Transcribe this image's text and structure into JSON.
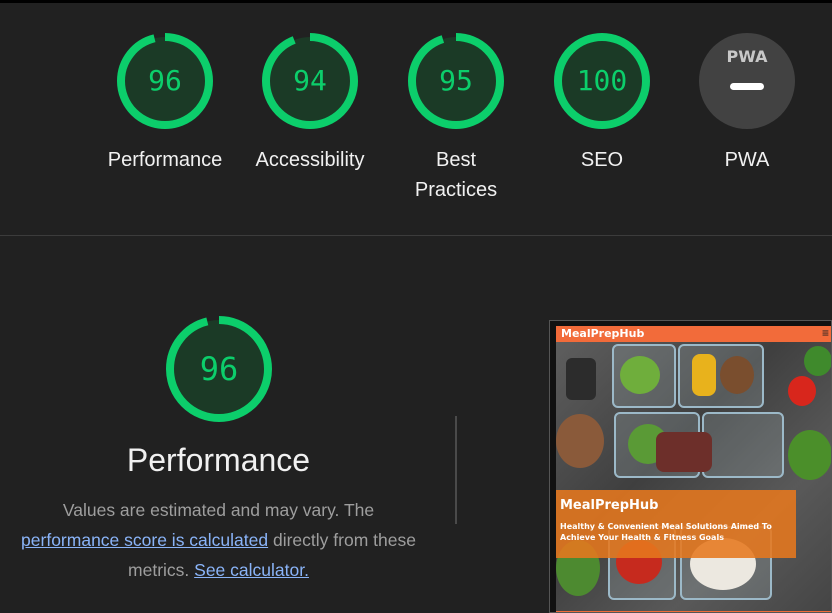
{
  "top_gauges": [
    {
      "score": "96",
      "label": "Performance",
      "fraction": 0.96
    },
    {
      "score": "94",
      "label": "Accessibility",
      "fraction": 0.94
    },
    {
      "score": "95",
      "label": "Best Practices",
      "fraction": 0.95
    },
    {
      "score": "100",
      "label": "SEO",
      "fraction": 1.0
    }
  ],
  "pwa": {
    "badge_text": "PWA",
    "label": "PWA"
  },
  "performance": {
    "score": "96",
    "fraction": 0.96,
    "title": "Performance",
    "desc_prefix": "Values are estimated and may vary. The",
    "link_score": "performance score is calculated",
    "desc_middle": "directly from these metrics.",
    "link_calc": "See calculator."
  },
  "thumbnail": {
    "brand": "MealPrepHub",
    "menu_icon": "hamburger-menu-icon",
    "menu_glyph": "≡",
    "banner_title": "MealPrepHub",
    "banner_sub": "Healthy & Convenient Meal Solutions Aimed To Achieve Your Health & Fitness Goals"
  },
  "colors": {
    "pass": "#0cce6b",
    "pass_bg": "#1b3a26",
    "link": "#8ab4f8",
    "accent": "#f26b3a"
  }
}
